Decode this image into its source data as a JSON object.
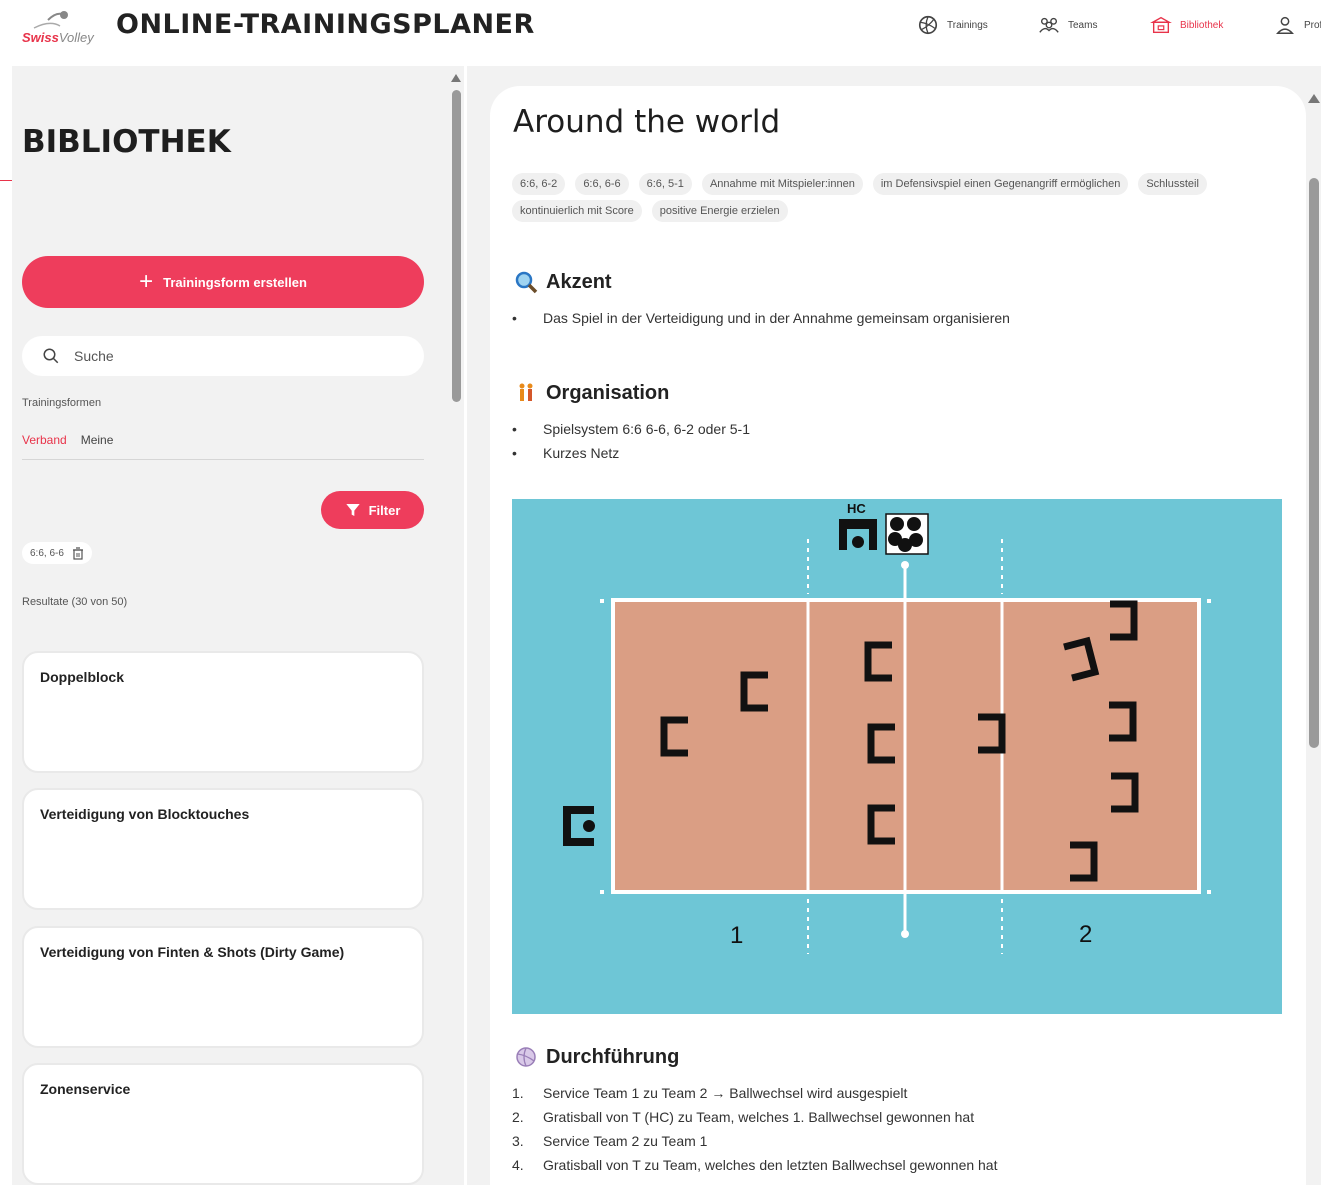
{
  "header": {
    "app_title": "ONLINE-TRAININGSPLANER",
    "logo_swiss": "Swiss",
    "logo_volley": "Volley",
    "nav": [
      {
        "label": "Trainings",
        "icon": "volleyball-icon",
        "active": false
      },
      {
        "label": "Teams",
        "icon": "team-icon",
        "active": false
      },
      {
        "label": "Bibliothek",
        "icon": "library-icon",
        "active": true
      },
      {
        "label": "Prof",
        "icon": "profile-icon",
        "active": false
      }
    ]
  },
  "library": {
    "title": "BIBLIOTHEK",
    "create_label": "Trainingsform erstellen",
    "search_placeholder": "Suche",
    "section_label": "Trainingsformen",
    "tabs": [
      "Verband",
      "Meine"
    ],
    "filter_label": "Filter",
    "active_filter": "6:6, 6-6",
    "results_text": "Resultate (30 von 50)",
    "cards": [
      "Doppelblock",
      "Verteidigung von Blocktouches",
      "Verteidigung von Finten & Shots (Dirty Game)",
      "Zonenservice"
    ]
  },
  "exercise": {
    "title": "Around the world",
    "tags": [
      "6:6, 6-2",
      "6:6, 6-6",
      "6:6, 5-1",
      "Annahme mit Mitspieler:innen",
      "im Defensivspiel einen Gegenangriff ermöglichen",
      "Schlussteil",
      "kontinuierlich mit Score",
      "positive Energie erzielen"
    ],
    "akzent": {
      "title": "Akzent",
      "items": [
        "Das Spiel in der Verteidigung und in der Annahme gemeinsam organisieren"
      ]
    },
    "organisation": {
      "title": "Organisation",
      "items": [
        "Spielsystem 6:6 6-6, 6-2 oder 5-1",
        "Kurzes Netz"
      ]
    },
    "court": {
      "coach_label": "HC",
      "team_left": "1",
      "team_right": "2",
      "colors": {
        "outer": "#6ec6d6",
        "court": "#da9e84"
      }
    },
    "durchfuehrung": {
      "title": "Durchführung",
      "items": [
        "Service Team 1 zu Team 2 → Ballwechsel wird ausgespielt",
        "Gratisball von T (HC) zu Team, welches 1. Ballwechsel gewonnen hat",
        "Service Team 2 zu Team 1",
        "Gratisball von T zu Team, welches den letzten Ballwechsel gewonnen hat"
      ]
    }
  },
  "colors": {
    "accent": "#ee3d5c"
  }
}
